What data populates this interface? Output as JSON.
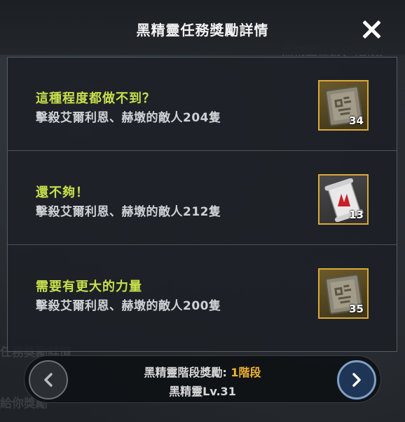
{
  "header": {
    "title": "黑精靈任務獎勵詳情"
  },
  "background": {
    "ghost_text_1": "黑精靈任務(5階段)",
    "ghost_text_2": "任務獎勵詳情",
    "ghost_text_3": "給你獎勵"
  },
  "rewards": [
    {
      "title": "這種程度都做不到？",
      "description": "擊殺艾爾利恩、赫墩的敵人204隻",
      "count": "34",
      "icon": "stone-tablet-icon"
    },
    {
      "title": "還不夠！",
      "description": "擊殺艾爾利恩、赫墩的敵人212隻",
      "count": "13",
      "icon": "scroll-icon"
    },
    {
      "title": "需要有更大的力量",
      "description": "擊殺艾爾利恩、赫墩的敵人200隻",
      "count": "35",
      "icon": "stone-tablet-icon"
    }
  ],
  "footer": {
    "stage_label": "黑精靈階段獎勵: ",
    "stage_value": "1階段",
    "level_text": "黑精靈Lv.31"
  },
  "colors": {
    "title_green": "#c7e04b",
    "stage_orange": "#f0b232",
    "reward_border": "#d9a93a"
  }
}
